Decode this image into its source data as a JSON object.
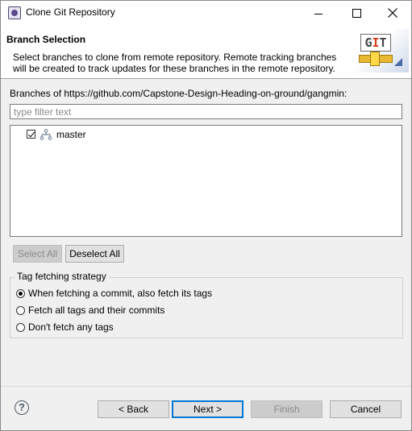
{
  "window": {
    "title": "Clone Git Repository"
  },
  "header": {
    "title": "Branch Selection",
    "description": "Select branches to clone from remote repository. Remote tracking branches will be created to track updates for these branches in the remote repository."
  },
  "branches": {
    "label": "Branches of https://github.com/Capstone-Design-Heading-on-ground/gangmin:",
    "filter_placeholder": "type filter text",
    "items": [
      {
        "name": "master",
        "checked": true
      }
    ]
  },
  "buttons": {
    "select_all": "Select All",
    "deselect_all": "Deselect All",
    "back": "< Back",
    "next": "Next >",
    "finish": "Finish",
    "cancel": "Cancel"
  },
  "tag_strategy": {
    "legend": "Tag fetching strategy",
    "options": [
      {
        "label": "When fetching a commit, also fetch its tags",
        "selected": true
      },
      {
        "label": "Fetch all tags and their commits",
        "selected": false
      },
      {
        "label": "Don't fetch any tags",
        "selected": false
      }
    ]
  },
  "icons": {
    "app": "eclipse-window-icon",
    "branch": "branch-icon",
    "help": "help-icon",
    "banner": "git-banner-icon"
  },
  "colors": {
    "default_button_border": "#0078d7",
    "git_red": "#d43c1c"
  }
}
